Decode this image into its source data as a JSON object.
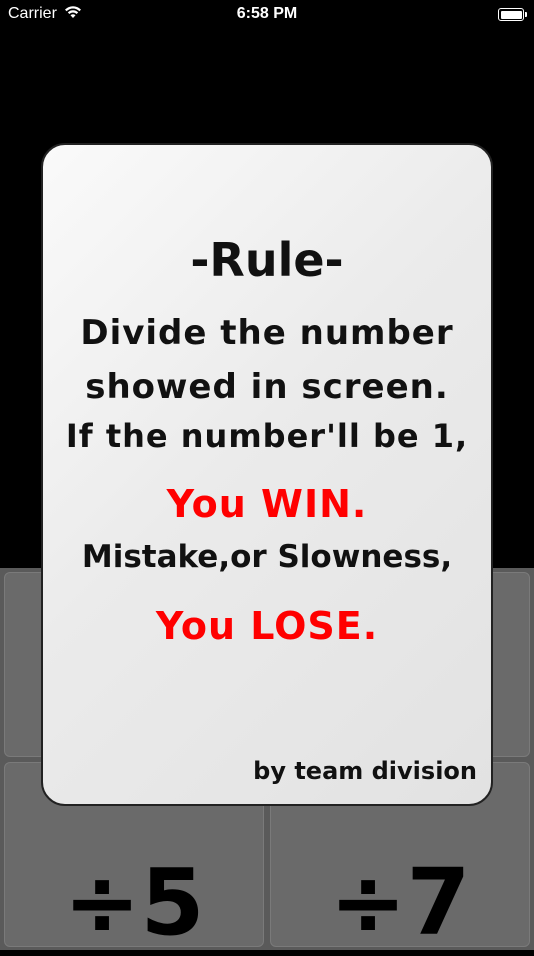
{
  "status_bar": {
    "carrier": "Carrier",
    "time": "6:58 PM"
  },
  "buttons": [
    {
      "label": ""
    },
    {
      "label": ""
    },
    {
      "label": "÷5"
    },
    {
      "label": "÷7"
    }
  ],
  "rule_card": {
    "title": "-Rule-",
    "lines": [
      "Divide the number",
      "showed in screen.",
      "If the number'll be 1,"
    ],
    "win_text": "You WIN.",
    "mistake_line": "Mistake,or Slowness,",
    "lose_text": "You LOSE.",
    "credit": "by team division"
  },
  "colors": {
    "win_lose": "#ff0000",
    "card_bg": "#e8e8e8",
    "button_bg": "#6a6a6a"
  }
}
